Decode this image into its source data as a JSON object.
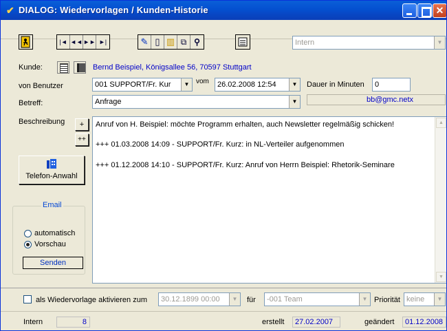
{
  "window": {
    "title": "DIALOG: Wiedervorlagen / Kunden-Historie",
    "app_icon": "checkmark-icon"
  },
  "toolbar": {
    "exit_icon": "exit-door-icon",
    "nav_icons": [
      "first-record-icon",
      "prev-record-icon",
      "next-record-icon",
      "last-record-icon"
    ],
    "nav_glyphs": [
      "|◄",
      "◄◄",
      "►►",
      "►|"
    ],
    "edit_icons": [
      "edit-pencil-icon",
      "new-document-icon",
      "delete-trash-icon",
      "copy-icon",
      "search-binoculars-icon"
    ],
    "edit_glyphs": [
      "✎",
      "▯",
      "▥",
      "⧉",
      "⚲"
    ],
    "print_icon": "print-icon",
    "view_select": "Intern"
  },
  "form": {
    "kunde_label": "Kunde:",
    "kunde_value": "Bernd Beispiel, Königsallee 56, 70597 Stuttgart",
    "benutzer_label": "von Benutzer",
    "benutzer_value": "001 SUPPORT/Fr. Kur",
    "vom_label": "vom",
    "datum_value": "26.02.2008  12:54",
    "dauer_label": "Dauer in Minuten",
    "dauer_value": "0",
    "betreff_label": "Betreff:",
    "betreff_value": "Anfrage",
    "email_value": "bb@gmc.netx",
    "beschreibung_label": "Beschreibung",
    "plus_label": "+",
    "plusplus_label": "++"
  },
  "memo": {
    "lines": [
      "Anruf von H. Beispiel: möchte Programm erhalten, auch Newsletter regelmäßig schicken!",
      "+++ 01.03.2008 14:09 - SUPPORT/Fr. Kurz: in NL-Verteiler aufgenommen",
      "+++ 01.12.2008 14:10 - SUPPORT/Fr. Kurz: Anruf von Herrn Beispiel: Rhetorik-Seminare"
    ]
  },
  "telefon": {
    "label": "Telefon-Anwahl",
    "icon": "phone-dial-icon"
  },
  "email_group": {
    "title": "Email",
    "options": [
      "automatisch",
      "Vorschau"
    ],
    "selected": "Vorschau",
    "send_label": "Senden"
  },
  "wiedervorlage": {
    "checkbox_label": "als Wiedervorlage aktivieren zum",
    "checked": false,
    "datum": "30.12.1899  00:00",
    "fuer_label": "für",
    "team": "-001 Team",
    "prioritaet_label": "Priorität",
    "prioritaet": "keine"
  },
  "status": {
    "intern_label": "Intern",
    "intern_value": "8",
    "erstellt_label": "erstellt",
    "erstellt_value": "27.02.2007",
    "geaendert_label": "geändert",
    "geaendert_value": "01.12.2008"
  }
}
